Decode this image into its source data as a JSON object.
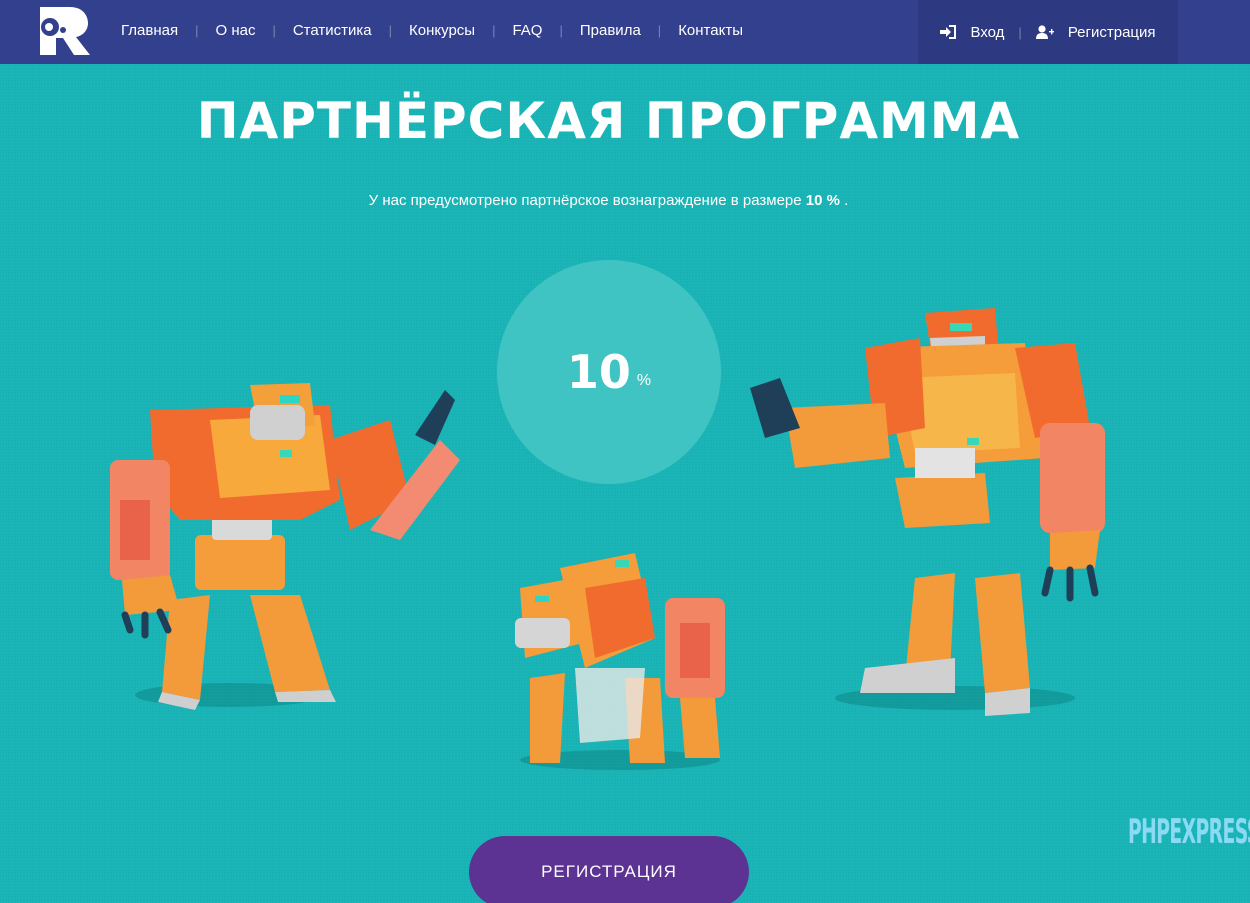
{
  "header": {
    "logo_letter": "R",
    "nav": [
      "Главная",
      "О нас",
      "Статистика",
      "Конкурсы",
      "FAQ",
      "Правила",
      "Контакты"
    ],
    "login_label": "Вход",
    "register_label": "Регистрация"
  },
  "hero": {
    "title": "ПАРТНЁРСКАЯ ПРОГРАММА",
    "subtitle_before": "У нас предусмотрено партнёрское вознаграждение в размере ",
    "subtitle_value": "10 %",
    "subtitle_after": " .",
    "circle_value": "10",
    "circle_unit": "%"
  },
  "cta": {
    "label": "РЕГИСТРАЦИЯ"
  },
  "watermark": "PHPEXPRESS",
  "colors": {
    "header_bg": "#33408d",
    "page_bg": "#17b3b4",
    "circle_bg": "#3fc4c3",
    "cta_bg": "#5c3393",
    "robot_orange": "#f5a53a",
    "robot_red": "#e5552d"
  }
}
